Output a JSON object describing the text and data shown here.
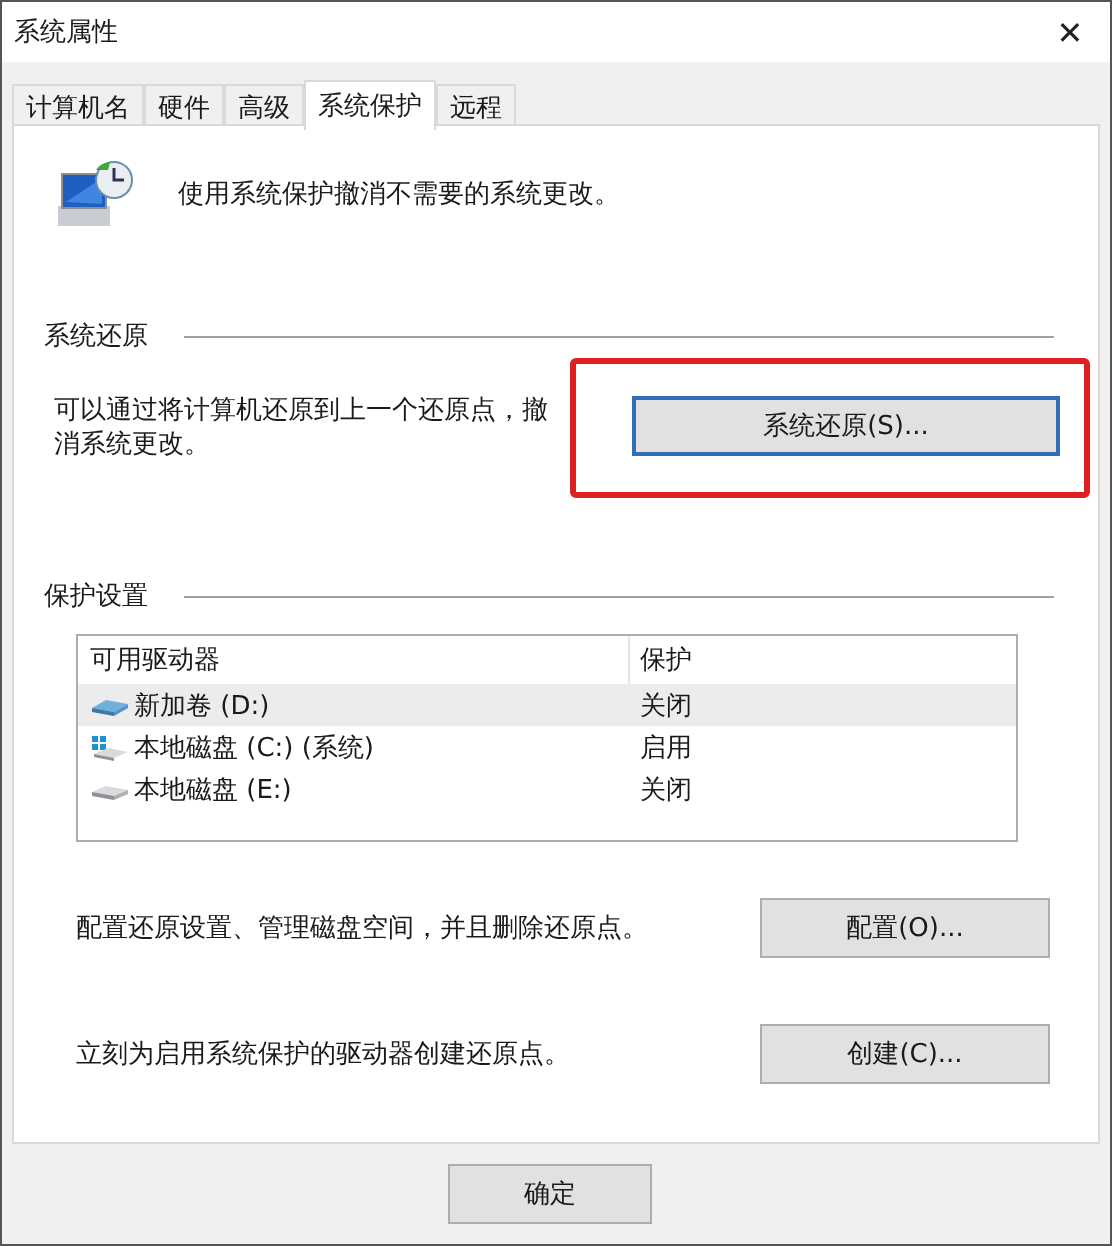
{
  "window": {
    "title": "系统属性",
    "close": "✕"
  },
  "tabs": [
    {
      "label": "计算机名",
      "selected": false
    },
    {
      "label": "硬件",
      "selected": false
    },
    {
      "label": "高级",
      "selected": false
    },
    {
      "label": "系统保护",
      "selected": true
    },
    {
      "label": "远程",
      "selected": false
    }
  ],
  "intro": "使用系统保护撤消不需要的系统更改。",
  "restore": {
    "heading": "系统还原",
    "text": "可以通过将计算机还原到上一个还原点，撤消系统更改。",
    "button": "系统还原(S)...",
    "highlighted": true
  },
  "protection": {
    "heading": "保护设置",
    "columns": [
      "可用驱动器",
      "保护"
    ],
    "rows": [
      {
        "kind": "volume",
        "drive": "新加卷 (D:)",
        "status": "关闭",
        "selected": true
      },
      {
        "kind": "system",
        "drive": "本地磁盘 (C:) (系统)",
        "status": "启用",
        "selected": false
      },
      {
        "kind": "disk",
        "drive": "本地磁盘 (E:)",
        "status": "关闭",
        "selected": false
      }
    ]
  },
  "configure": {
    "text": "配置还原设置、管理磁盘空间，并且删除还原点。",
    "button": "配置(O)..."
  },
  "create": {
    "text": "立刻为启用系统保护的驱动器创建还原点。",
    "button": "创建(C)..."
  },
  "buttons": [
    "确定"
  ]
}
